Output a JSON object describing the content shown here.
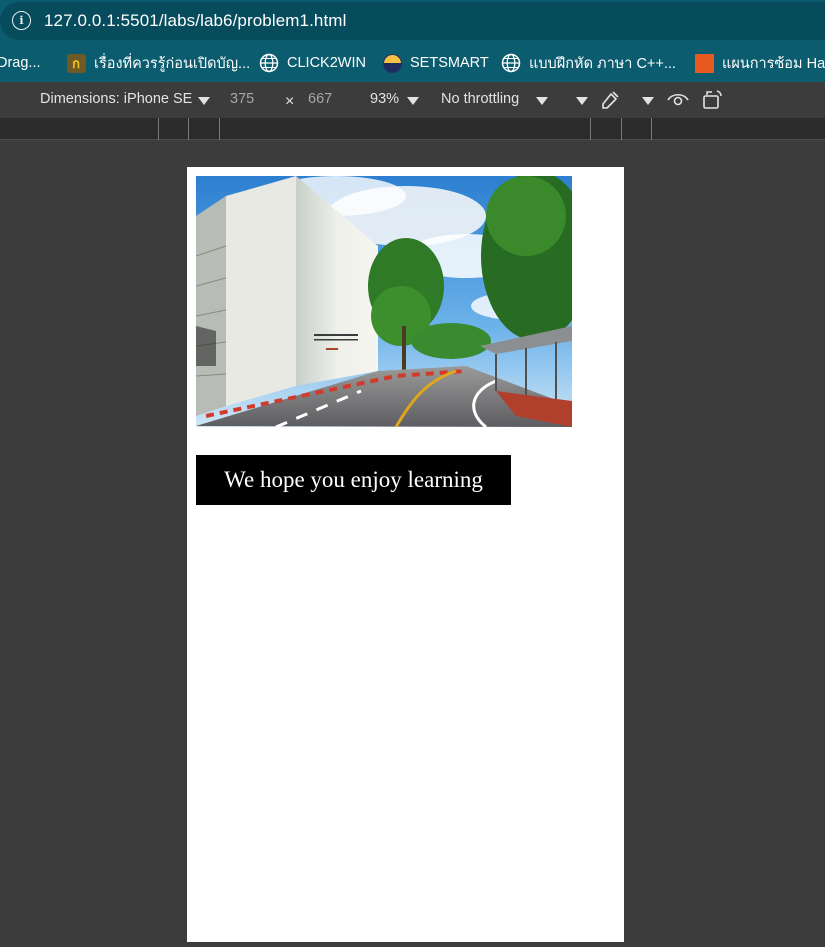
{
  "browser": {
    "url": "127.0.0.1:5501/labs/lab6/problem1.html"
  },
  "bookmarks": [
    {
      "label": "Drag...",
      "icon": "none"
    },
    {
      "label": "เรื่องที่ควรรู้ก่อนเปิดบัญ...",
      "icon": "krungsri-logo-icon"
    },
    {
      "label": "CLICK2WIN",
      "icon": "globe-icon"
    },
    {
      "label": "SETSMART",
      "icon": "setsmart-logo-icon"
    },
    {
      "label": "แบบฝึกหัด ภาษา C++...",
      "icon": "globe-icon"
    },
    {
      "label": "แผนการซ้อม Half",
      "icon": "orange-square-icon"
    }
  ],
  "devtools": {
    "dimensions_label": "Dimensions: iPhone SE",
    "width": "375",
    "separator": "×",
    "height": "667",
    "zoom": "93%",
    "throttling": "No throttling"
  },
  "page": {
    "photo_alt": "Campus building and road",
    "message": "We hope you enjoy learning"
  },
  "colors": {
    "browser_chrome": "#0b5c6e",
    "devtools_bg": "#3c3c3c",
    "message_bg": "#000000",
    "message_text": "#ffffff"
  }
}
